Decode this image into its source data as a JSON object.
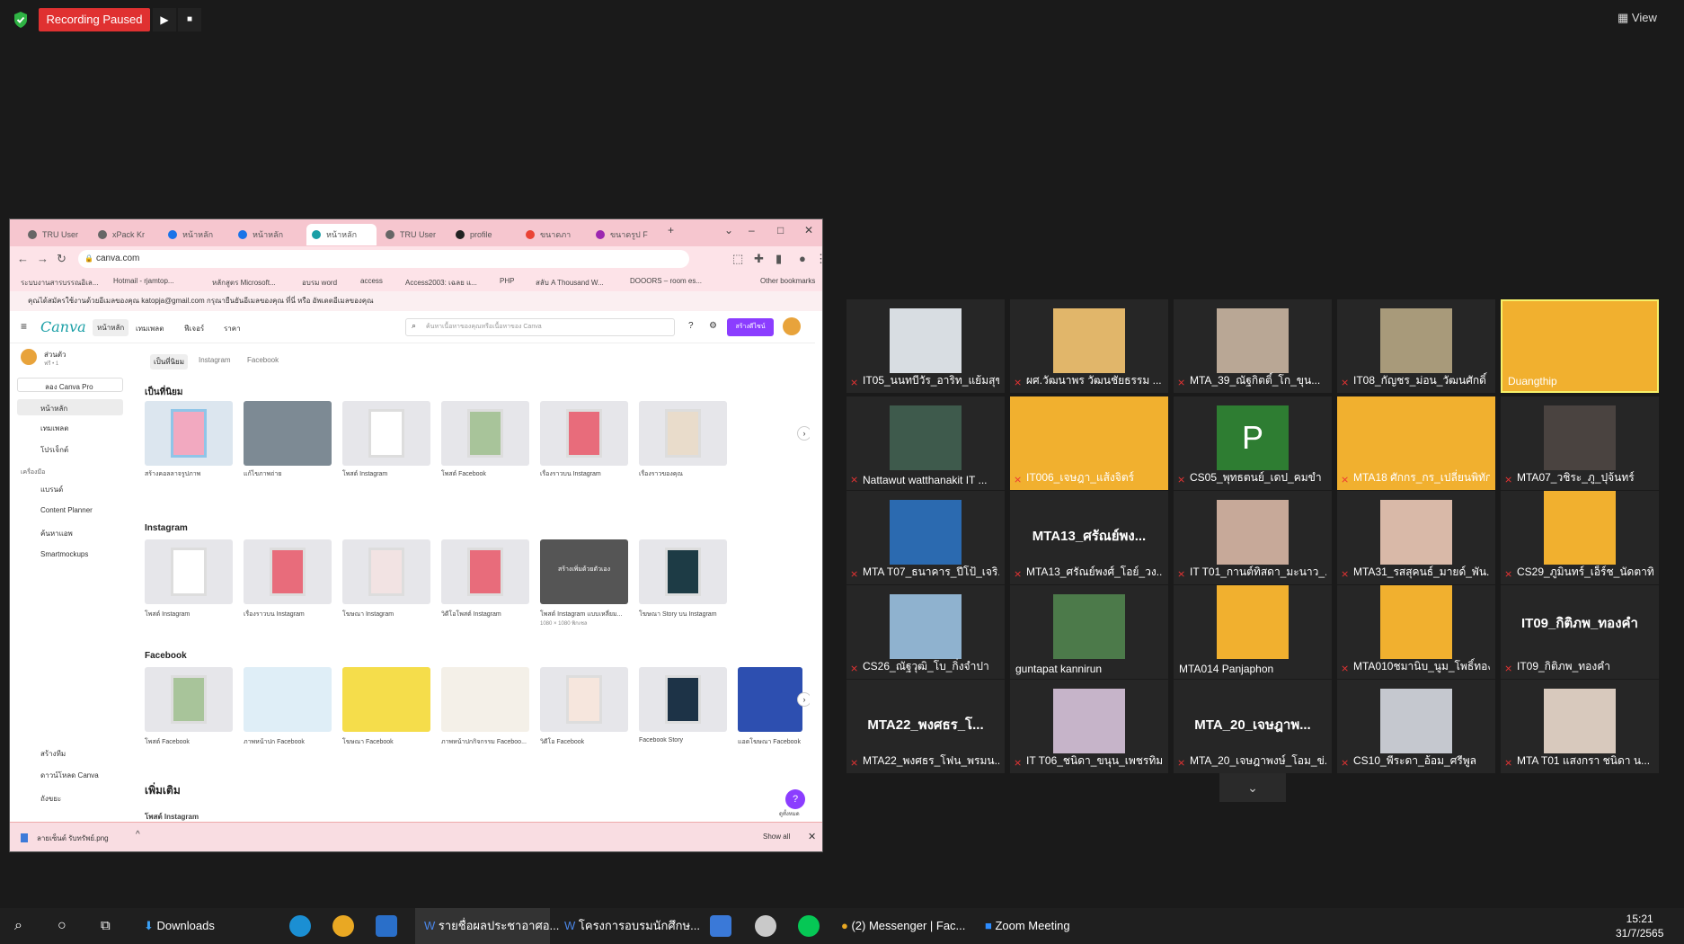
{
  "meeting": {
    "recording_label": "Recording Paused",
    "view_label": "View"
  },
  "browser": {
    "tabs": [
      "TRU User",
      "xPack Kr",
      "หน้าหลัก",
      "หน้าหลัก",
      "หน้าหลัก",
      "TRU User",
      "profile",
      "ขนาดภา",
      "ขนาดรูป F"
    ],
    "url": "canva.com",
    "bookmarks": [
      "ระบบงานสารบรรณอิเล...",
      "Hotmail - rjamtop...",
      "หลักสูตร Microsoft...",
      "อบรม word",
      "access",
      "Access2003: เฉลย แ...",
      "PHP",
      "สลับ A Thousand W...",
      "DOOORS – room es...",
      "Other bookmarks"
    ],
    "warning": "คุณได้สมัครใช้งานด้วยอีเมลของคุณ katopja@gmail.com กรุณายืนยันอีเมลของคุณ ที่นี่ หรือ อัพเดตอีเมลของคุณ"
  },
  "canva": {
    "logo": "Canva",
    "nav": [
      "หน้าหลัก",
      "เทมเพลต",
      "ฟีเจอร์",
      "ราคา"
    ],
    "search_placeholder": "ค้นหาเนื้อหาของคุณหรือเนื้อหาของ Canva",
    "create_label": "สร้างดีไซน์",
    "team_name": "ส่วนตัว",
    "team_sub": "ฟรี • 1",
    "pro_btn": "ลอง Canva Pro",
    "sidebar": [
      "หน้าหลัก",
      "เทมเพลต",
      "โปรเจ็กต์",
      "เครื่องมือ",
      "แบรนด์",
      "Content Planner",
      "ค้นหาแอพ",
      "Smartmockups",
      "สร้างทีม",
      "ดาวน์โหลด Canva",
      "ถังขยะ"
    ],
    "subtabs": [
      "เป็นที่นิยม",
      "Instagram",
      "Facebook"
    ],
    "sections": [
      "เป็นที่นิยม",
      "Instagram",
      "Facebook",
      "เพิ่มเติม"
    ],
    "popular": [
      "สร้างคอลลาจรูปภาพ",
      "แก้ไขภาพถ่าย",
      "โพสต์ Instagram",
      "โพสต์ Facebook",
      "เรื่องราวบน Instagram",
      "เรื่องราวของคุณ"
    ],
    "instagram": [
      "โพสต์ Instagram",
      "เรื่องราวบน Instagram",
      "โฆษณา Instagram",
      "วิดีโอโพสต์ Instagram",
      "โพสต์ Instagram แบบเหลี่ยม...",
      "โฆษณา Story บน Instagram"
    ],
    "instagram_card_text": "สร้างเพิ่มด้วยตัวเอง",
    "instagram_size": "1080 × 1080 พิกเซล",
    "facebook": [
      "โพสต์ Facebook",
      "ภาพหน้าปก Facebook",
      "โฆษณา Facebook",
      "ภาพหน้าปกกิจกรรม Faceboo...",
      "วิดีโอ Facebook",
      "Facebook Story",
      "แอดโฆษณา Facebook"
    ],
    "more_label": "โพสต์ Instagram",
    "more_link": "ดูทั้งหมด",
    "download_file": "ลายเซ็นต์ รับทรัพย์.png",
    "show_all": "Show all"
  },
  "participants": [
    "IT05_นนทบีวัร_อาริท_แย้มสุข",
    "ผศ.วัฒนาพร วัฒนชัยธรรม ...",
    "MTA_39_ณัฐกิตติ์_โก_ขุน...",
    "IT08_กัญชร_ม่อน_วัฒนศักดิ์",
    "Duangthip",
    "Nattawut watthanakit IT ...",
    "IT006_เจษฎา_แส้งจิตร์",
    "CS05_พุทธตนย์_เดป_คมขำ",
    "MTA18 ศักกร_กร_เปลี่ยนพิทัก...",
    "MTA07_วชิระ_ภู_ปุจ้นทร์",
    "MTA T07_ธนาคาร_ปีโป้_เจริ...",
    "MTA13_ศรัณย์พงศ์_โอย์_วง...",
    "IT T01_กานต์ทิสดา_มะนาว_...",
    "MTA31_รสสุคนธ์_มายด์_พัน...",
    "CS29_ภูมินทร์_เอ็ร์ช_นัดตาทิ...",
    "CS26_ณัฐวุฒิ_โบ_กิ่งจำปา",
    "guntapat kannirun",
    "MTA014 Panjaphon",
    "MTA010ชมานิบ_นูม_โพธิ์ทอง",
    "IT09_กิติภพ_ทองคำ",
    "MTA22_พงศธร_โฟน_พรมน...",
    "IT T06_ชนิดา_ขนุน_เพชรทิม",
    "MTA_20_เจษฎาพงษ์_โอม_ข่...",
    "CS10_พีระดา_อ้อม_ศรีพูล",
    "MTA T01 แสงกรา ชนิดา น..."
  ],
  "big_names": {
    "MTA13": "MTA13_ศรัณย์พง...",
    "IT09": "IT09_กิติภพ_ทองคำ",
    "MTA22": "MTA22_พงศธร_โ...",
    "MTA20": "MTA_20_เจษฎาพ..."
  },
  "p_letter": "P",
  "taskbar": {
    "items": [
      "Downloads",
      "รายชื่อผลประชาอาศอ...",
      "โครงการอบรมนักศึกษ...",
      "(2) Messenger | Fac...",
      "Zoom Meeting"
    ],
    "time": "15:21",
    "date": "31/7/2565"
  },
  "colors": {
    "recording": "#e03131",
    "canva_purple": "#8b3dff",
    "gold_bg": "#f1b02f",
    "highlight": "#f6f16a"
  }
}
